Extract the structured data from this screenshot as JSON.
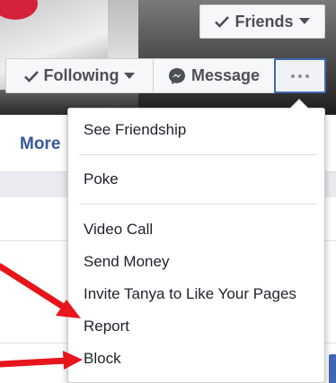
{
  "header": {
    "friends_label": "Friends",
    "following_label": "Following",
    "message_label": "Message",
    "more_label": "···"
  },
  "tabs": {
    "more_label": "More"
  },
  "dropdown": {
    "items": [
      "See Friendship",
      "Poke",
      "Video Call",
      "Send Money",
      "Invite Tanya to Like Your Pages",
      "Report",
      "Block"
    ]
  },
  "colors": {
    "accent": "#4267b2",
    "arrow": "#e8141b",
    "link": "#365899"
  }
}
